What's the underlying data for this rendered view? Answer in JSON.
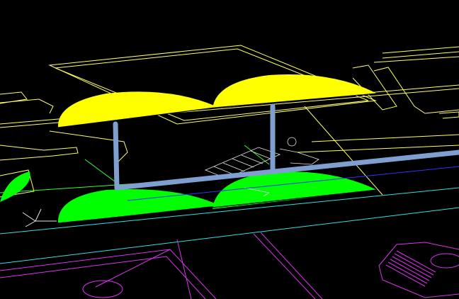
{
  "viewport": {
    "background": "#000000",
    "colors": {
      "yellow_fill": "#ffff00",
      "green_fill": "#00ff00",
      "yellow_line": "#ffff66",
      "green_line": "#33ff33",
      "cyan_line": "#33e0e0",
      "magenta_line": "#dd33ee",
      "blue_line": "#3333ff",
      "white_line": "#e6e6e6",
      "pipe": "#7f9fd0"
    },
    "icons": [
      "ucs-icon"
    ]
  }
}
